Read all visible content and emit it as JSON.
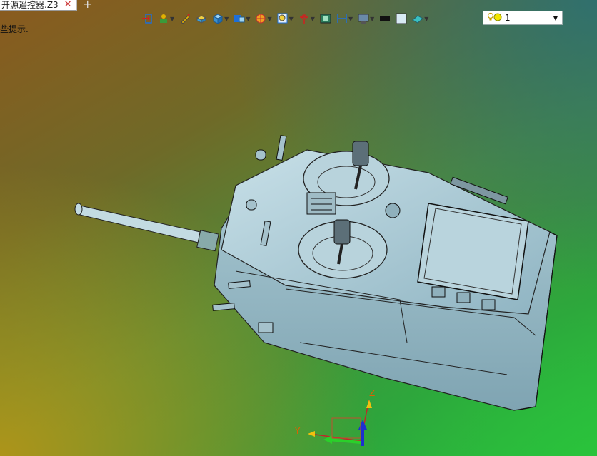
{
  "tab": {
    "title": "开源遥控器.Z3",
    "close": "✕",
    "add": "+"
  },
  "hint": "些提示.",
  "toolbar": {
    "items": [
      {
        "icon": "exit-sketch-icon",
        "has_menu": false
      },
      {
        "icon": "display-mode-icon",
        "has_menu": true
      },
      {
        "icon": "pencil-icon",
        "has_menu": false
      },
      {
        "icon": "layer-box-icon",
        "has_menu": false
      },
      {
        "icon": "shaded-cube-icon",
        "has_menu": true
      },
      {
        "icon": "view-cube-icon",
        "has_menu": true
      },
      {
        "icon": "color-wheel-icon",
        "has_menu": true
      },
      {
        "icon": "zoom-icon",
        "has_menu": true
      },
      {
        "icon": "pin-icon",
        "has_menu": true
      },
      {
        "icon": "screen-icon",
        "has_menu": false
      },
      {
        "icon": "measure-icon",
        "has_menu": true
      },
      {
        "icon": "monitor-icon",
        "has_menu": true
      },
      {
        "icon": "black-swatch-icon",
        "has_menu": false
      },
      {
        "icon": "white-swatch-icon",
        "has_menu": false
      },
      {
        "icon": "surface-icon",
        "has_menu": true
      }
    ]
  },
  "layer": {
    "value": "1",
    "arrow": "▼"
  },
  "triad": {
    "z_label": "Z",
    "y_label": "Y"
  },
  "colors": {
    "accent": "#1e6fd8",
    "model": "#a9c9d4"
  }
}
